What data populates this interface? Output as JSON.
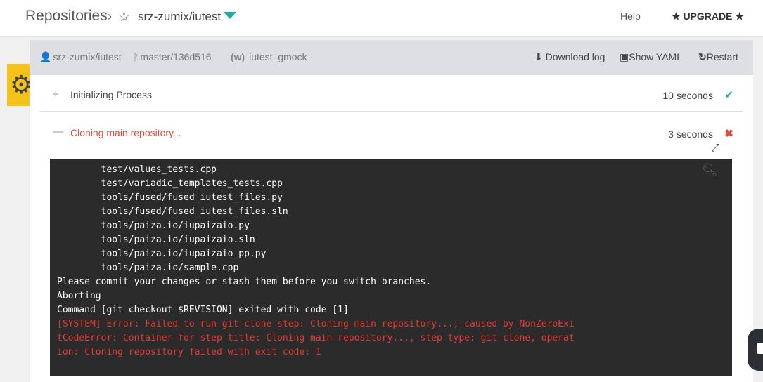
{
  "header": {
    "breadcrumb_root": "Repositories",
    "breadcrumb_separator": "›",
    "repo_name": "srz-zumix/iutest",
    "help_label": "Help",
    "upgrade_label": "★ UPGRADE ★"
  },
  "build": {
    "repo": "srz-zumix/iutest",
    "branch": "master/136d516",
    "pipeline": "iutest_gmock",
    "download_log_label": "Download log",
    "show_yaml_label": "Show YAML",
    "restart_label": "Restart"
  },
  "steps": [
    {
      "title": "Initializing Process",
      "duration": "10 seconds",
      "status": "success",
      "toggle": "+"
    },
    {
      "title": "Cloning main repository...",
      "duration": "3 seconds",
      "status": "failed",
      "toggle": "—"
    }
  ],
  "log_lines": [
    {
      "text": "        test/values_tests.cpp",
      "kind": "normal"
    },
    {
      "text": "        test/variadic_templates_tests.cpp",
      "kind": "normal"
    },
    {
      "text": "        tools/fused/fused_iutest_files.py",
      "kind": "normal"
    },
    {
      "text": "        tools/fused/fused_iutest_files.sln",
      "kind": "normal"
    },
    {
      "text": "        tools/paiza.io/iupaizaio.py",
      "kind": "normal"
    },
    {
      "text": "        tools/paiza.io/iupaizaio.sln",
      "kind": "normal"
    },
    {
      "text": "        tools/paiza.io/iupaizaio_pp.py",
      "kind": "normal"
    },
    {
      "text": "        tools/paiza.io/sample.cpp",
      "kind": "normal"
    },
    {
      "text": "Please commit your changes or stash them before you switch branches.",
      "kind": "normal"
    },
    {
      "text": "Aborting",
      "kind": "normal"
    },
    {
      "text": "Command [git checkout $REVISION] exited with code [1]",
      "kind": "normal"
    },
    {
      "text": "[SYSTEM] Error: Failed to run git-clone step: Cloning main repository...; caused by NonZeroExi",
      "kind": "error"
    },
    {
      "text": "tCodeError: Container for step title: Cloning main repository..., step type: git-clone, operat",
      "kind": "error"
    },
    {
      "text": "ion: Cloning repository failed with exit code: 1",
      "kind": "error"
    }
  ],
  "icons": {
    "star": "star-outline-icon",
    "caret": "caret-down-icon",
    "gear": "gear-icon",
    "user": "user-icon",
    "branch": "branch-icon",
    "pipeline": "pipeline-icon",
    "download": "download-icon",
    "yaml": "file-code-icon",
    "restart": "restart-icon",
    "check": "check-icon",
    "error": "x-icon",
    "expand": "expand-icon",
    "search": "search-icon",
    "chat": "chat-icon"
  },
  "colors": {
    "accent": "#1aab9b",
    "error": "#e04b3b",
    "terminal_bg": "#2b2b2b",
    "side_tab": "#f4c21a"
  }
}
